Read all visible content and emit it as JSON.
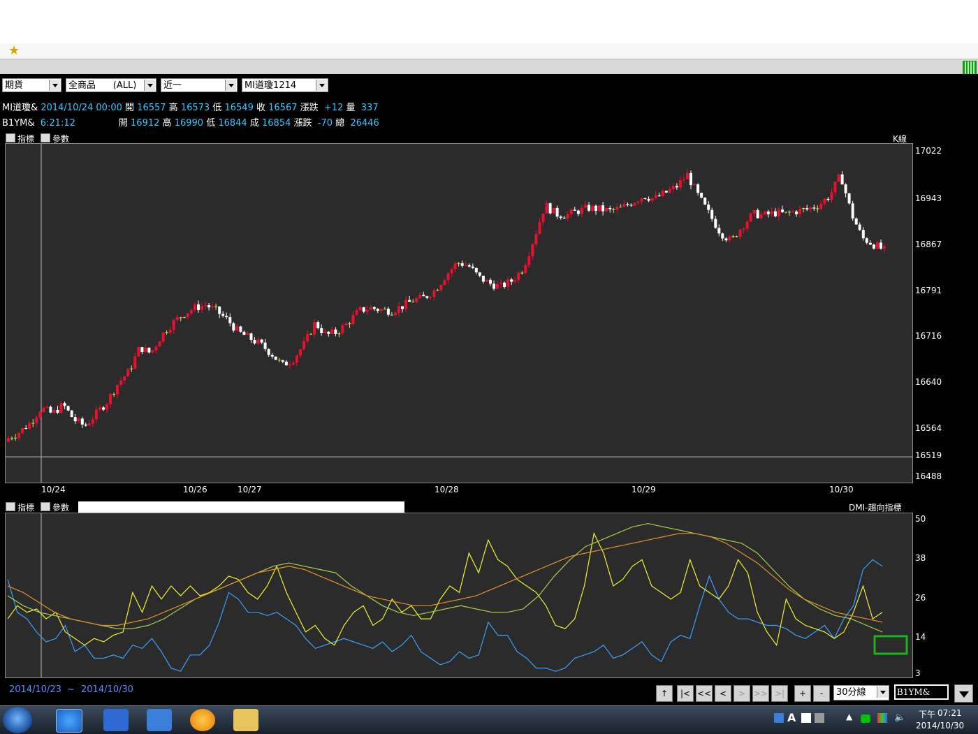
{
  "selectors": [
    {
      "id": "market",
      "value": "期貨"
    },
    {
      "id": "product",
      "value": "全商品      (ALL)"
    },
    {
      "id": "month",
      "value": "近一"
    },
    {
      "id": "contract",
      "value": "MI道瓊1214"
    }
  ],
  "quote1": {
    "symbol": "MI道瓊&",
    "datetime": "2014/10/24 00:00",
    "open_label": "開",
    "open": "16557",
    "high_label": "高",
    "high": "16573",
    "low_label": "低",
    "low": "16549",
    "close_label": "收",
    "close": "16567",
    "chg_label": "漲跌",
    "chg": "+12",
    "vol_label": "量",
    "vol": "337"
  },
  "quote2": {
    "symbol": "B1YM&",
    "time": "6:21:12",
    "open_label": "開",
    "open": "16912",
    "high_label": "高",
    "high": "16990",
    "low_label": "低",
    "low": "16844",
    "close_label": "成",
    "close": "16854",
    "chg_label": "漲跌",
    "chg": "-70",
    "vol_label": "總",
    "vol": "26446"
  },
  "panel_controls": {
    "indicator": "指標",
    "params": "參數"
  },
  "colors": {
    "up": "#e8112d",
    "down": "#ffffff",
    "doji": "#e8e05a",
    "blue": "#3aa0ff",
    "yellow": "#f2f233",
    "green": "#a8d04a",
    "orange": "#e8902a"
  },
  "range_start": "2014/10/23",
  "range_tilde": "~",
  "range_end": "2014/10/30",
  "nav_buttons": [
    "↑",
    "|<",
    "<<",
    "<",
    ">",
    ">>",
    ">|",
    "+",
    "-"
  ],
  "interval": "30分線",
  "symbol_input": "B1YM&",
  "taskbar": {
    "time": "07:21",
    "ampm": "下午",
    "date": "2014/10/30",
    "ime": "A"
  },
  "chart_data": [
    {
      "type": "candlestick",
      "legend": "K線",
      "y_ticks": [
        17022,
        16943,
        16867,
        16791,
        16716,
        16640,
        16564,
        16519,
        16488
      ],
      "ylim": [
        16488,
        17022
      ],
      "x_ticks": [
        "10/24",
        "10/26",
        "10/27",
        "10/28",
        "10/29",
        "10/30"
      ],
      "close_path": [
        16550,
        16560,
        16575,
        16600,
        16590,
        16605,
        16580,
        16570,
        16590,
        16610,
        16640,
        16660,
        16700,
        16690,
        16720,
        16740,
        16755,
        16765,
        16770,
        16760,
        16745,
        16725,
        16715,
        16705,
        16690,
        16670,
        16680,
        16705,
        16740,
        16720,
        16725,
        16740,
        16760,
        16765,
        16762,
        16760,
        16768,
        16778,
        16782,
        16795,
        16820,
        16840,
        16835,
        16815,
        16805,
        16800,
        16810,
        16830,
        16880,
        16935,
        16920,
        16918,
        16925,
        16930,
        16928,
        16925,
        16930,
        16940,
        16950,
        16945,
        16955,
        16965,
        16985,
        16950,
        16920,
        16890,
        16875,
        16900,
        16920,
        16918,
        16922,
        16920,
        16925,
        16928,
        16935,
        16950,
        16985,
        16920,
        16880,
        16870,
        16860
      ]
    },
    {
      "type": "line",
      "legend": "DMI-趨向指標",
      "y_ticks": [
        50,
        38,
        26,
        14,
        3
      ],
      "ylim": [
        3,
        50
      ],
      "series": [
        {
          "color": "#3aa0ff",
          "values": [
            32,
            22,
            20,
            16,
            13,
            14,
            18,
            10,
            12,
            8,
            8,
            9,
            8,
            12,
            11,
            14,
            10,
            5,
            4,
            9,
            9,
            12,
            19,
            28,
            26,
            22,
            22,
            21,
            22,
            20,
            18,
            14,
            11,
            12,
            13,
            14,
            13,
            12,
            11,
            13,
            10,
            12,
            15,
            10,
            8,
            6,
            7,
            10,
            8,
            9,
            19,
            15,
            15,
            10,
            8,
            5,
            5,
            4,
            5,
            8,
            9,
            10,
            12,
            8,
            9,
            11,
            13,
            9,
            7,
            13,
            15,
            14,
            24,
            33,
            26,
            22,
            20,
            20,
            19,
            18,
            18,
            17,
            15,
            14,
            16,
            18,
            14,
            20,
            24,
            35,
            38,
            36
          ]
        },
        {
          "color": "#f2f233",
          "values": [
            20,
            24,
            22,
            23,
            20,
            22,
            16,
            14,
            12,
            14,
            13,
            15,
            16,
            28,
            22,
            30,
            26,
            30,
            27,
            30,
            27,
            28,
            30,
            33,
            32,
            28,
            26,
            30,
            36,
            28,
            22,
            16,
            18,
            14,
            12,
            18,
            22,
            24,
            18,
            20,
            26,
            22,
            24,
            20,
            20,
            26,
            30,
            28,
            40,
            34,
            44,
            38,
            36,
            32,
            30,
            28,
            24,
            18,
            17,
            20,
            30,
            46,
            40,
            30,
            32,
            36,
            38,
            30,
            28,
            26,
            28,
            38,
            30,
            28,
            26,
            30,
            38,
            34,
            22,
            16,
            12,
            26,
            20,
            18,
            17,
            16,
            14,
            16,
            22,
            30,
            20,
            22
          ]
        },
        {
          "color": "#a8d04a",
          "values": [
            27,
            24,
            22,
            21,
            20,
            19,
            18,
            17,
            17,
            18,
            20,
            23,
            26,
            28,
            30,
            32,
            34,
            36,
            37,
            36,
            35,
            34,
            30,
            27,
            24,
            22,
            21,
            22,
            23,
            24,
            23,
            22,
            22,
            23,
            27,
            33,
            38,
            42,
            44,
            46,
            48,
            49,
            48,
            47,
            46,
            45,
            44,
            43,
            40,
            35,
            30,
            26,
            23,
            21,
            20,
            18,
            16
          ]
        },
        {
          "color": "#e8902a",
          "values": [
            30,
            28,
            25,
            22,
            20,
            19,
            18,
            18,
            19,
            20,
            22,
            24,
            26,
            28,
            30,
            32,
            34,
            35,
            36,
            35,
            33,
            31,
            29,
            27,
            26,
            25,
            24,
            24,
            25,
            26,
            27,
            29,
            31,
            33,
            35,
            37,
            39,
            40,
            41,
            42,
            43,
            44,
            45,
            46,
            46,
            45,
            43,
            40,
            37,
            33,
            29,
            26,
            24,
            22,
            21,
            20,
            19
          ]
        }
      ]
    }
  ]
}
